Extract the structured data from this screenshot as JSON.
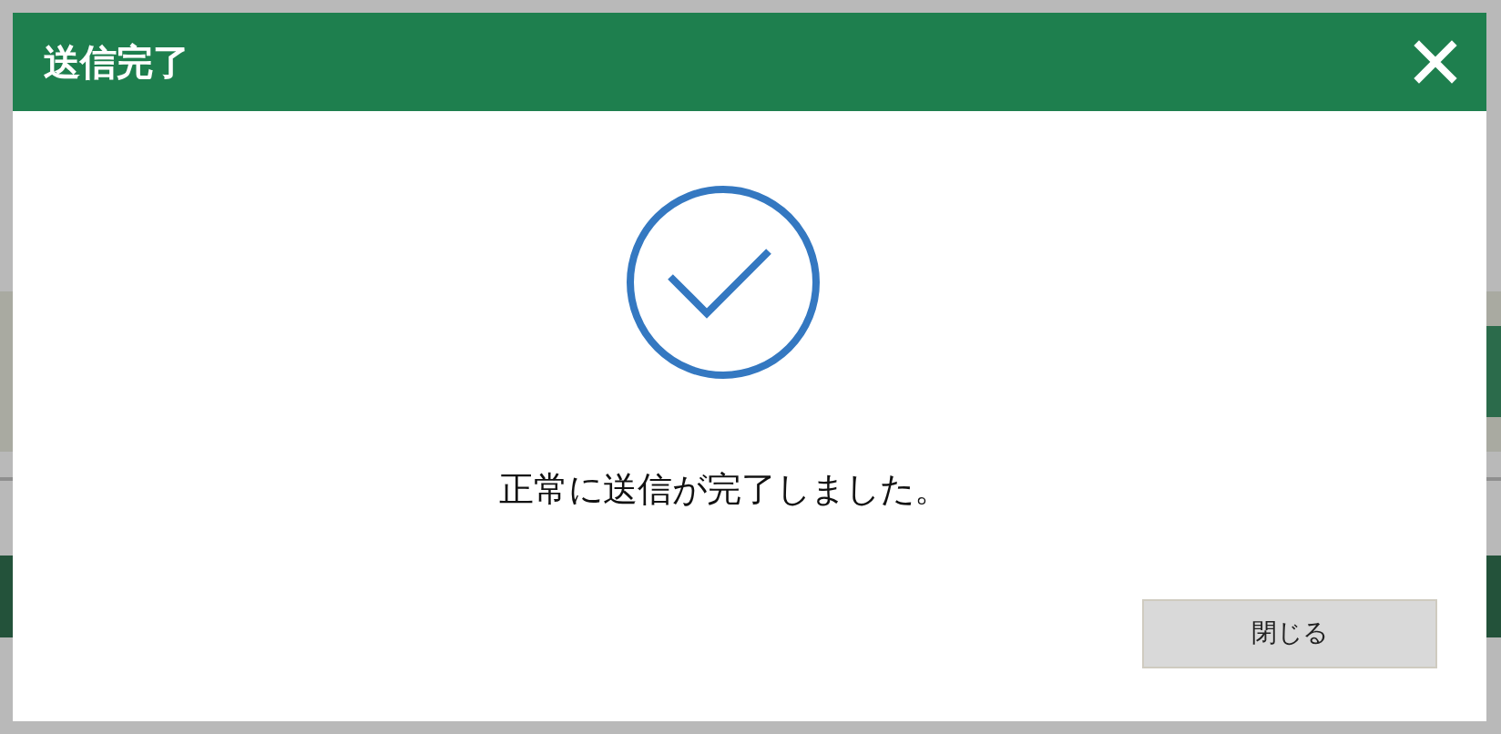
{
  "dialog": {
    "title": "送信完了",
    "message": "正常に送信が完了しました。",
    "buttons": [
      {
        "label": "閉じる"
      }
    ]
  }
}
